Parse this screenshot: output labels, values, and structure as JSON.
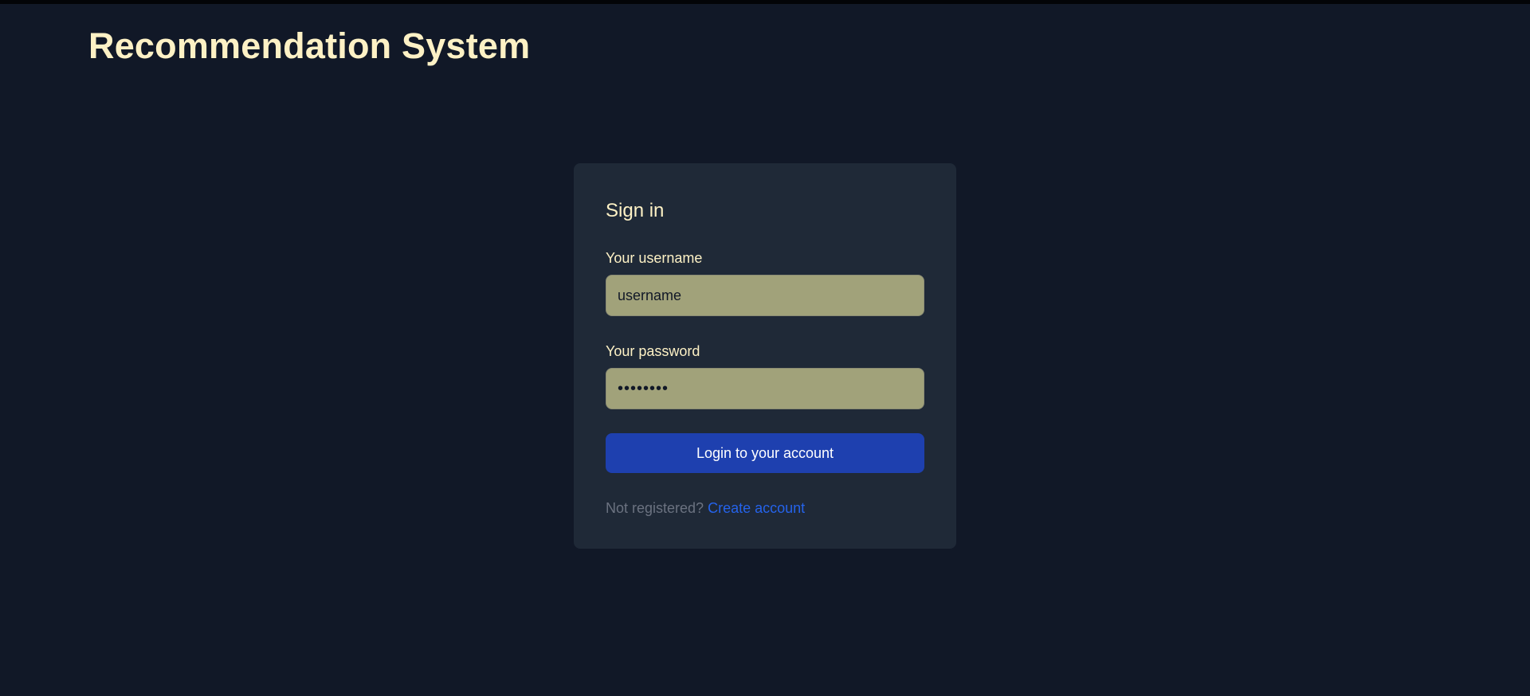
{
  "header": {
    "title": "Recommendation System"
  },
  "signin_card": {
    "title": "Sign in",
    "username_label": "Your username",
    "username_value": "username",
    "password_label": "Your password",
    "password_value": "password",
    "submit_label": "Login to your account",
    "not_registered_text": "Not registered?",
    "create_account_link": "Create account"
  },
  "colors": {
    "background": "#111827",
    "card": "#1f2937",
    "title_text": "#fdf1c5",
    "input_fill": "#a1a27a",
    "button": "#1e40af",
    "link": "#2563eb",
    "muted_text": "#6b7280"
  }
}
